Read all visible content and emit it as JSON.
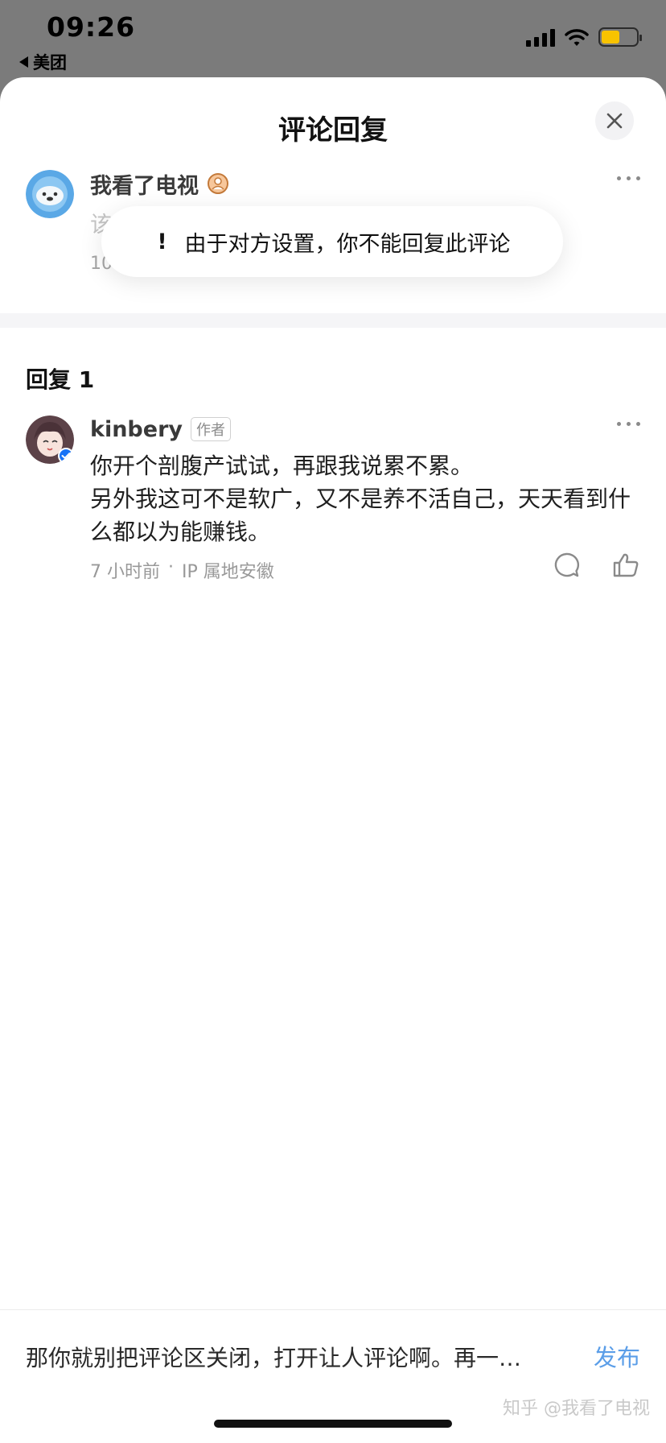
{
  "status_bar": {
    "time": "09:26",
    "back_app_label": "美团",
    "battery_color": "#f8c300"
  },
  "sheet": {
    "title": "评论回复",
    "close_icon": "close-icon"
  },
  "original_comment": {
    "author": "我看了电视",
    "badge_icon": "medal-icon",
    "text_partial": "该",
    "meta_partial": "10",
    "more_icon": "more-dots-icon"
  },
  "toast": {
    "icon": "!",
    "message": "由于对方设置，你不能回复此评论"
  },
  "replies_section": {
    "title": "回复 1",
    "replies": [
      {
        "author": "kinbery",
        "author_tag": "作者",
        "verified_icon": "verified-check-icon",
        "text": "你开个剖腹产试试，再跟我说累不累。\n另外我这可不是软广，又不是养不活自己，天天看到什么都以为能赚钱。",
        "time": "7 小时前",
        "separator": "·",
        "ip_location": "IP 属地安徽",
        "comment_icon": "comment-bubble-icon",
        "like_icon": "thumbs-up-icon"
      }
    ]
  },
  "composer": {
    "input_value": "那你就别把评论区关闭，打开让人评论啊。再一…",
    "publish_label": "发布",
    "publish_color": "#5b9ee8"
  },
  "watermark": "知乎 @我看了电视"
}
